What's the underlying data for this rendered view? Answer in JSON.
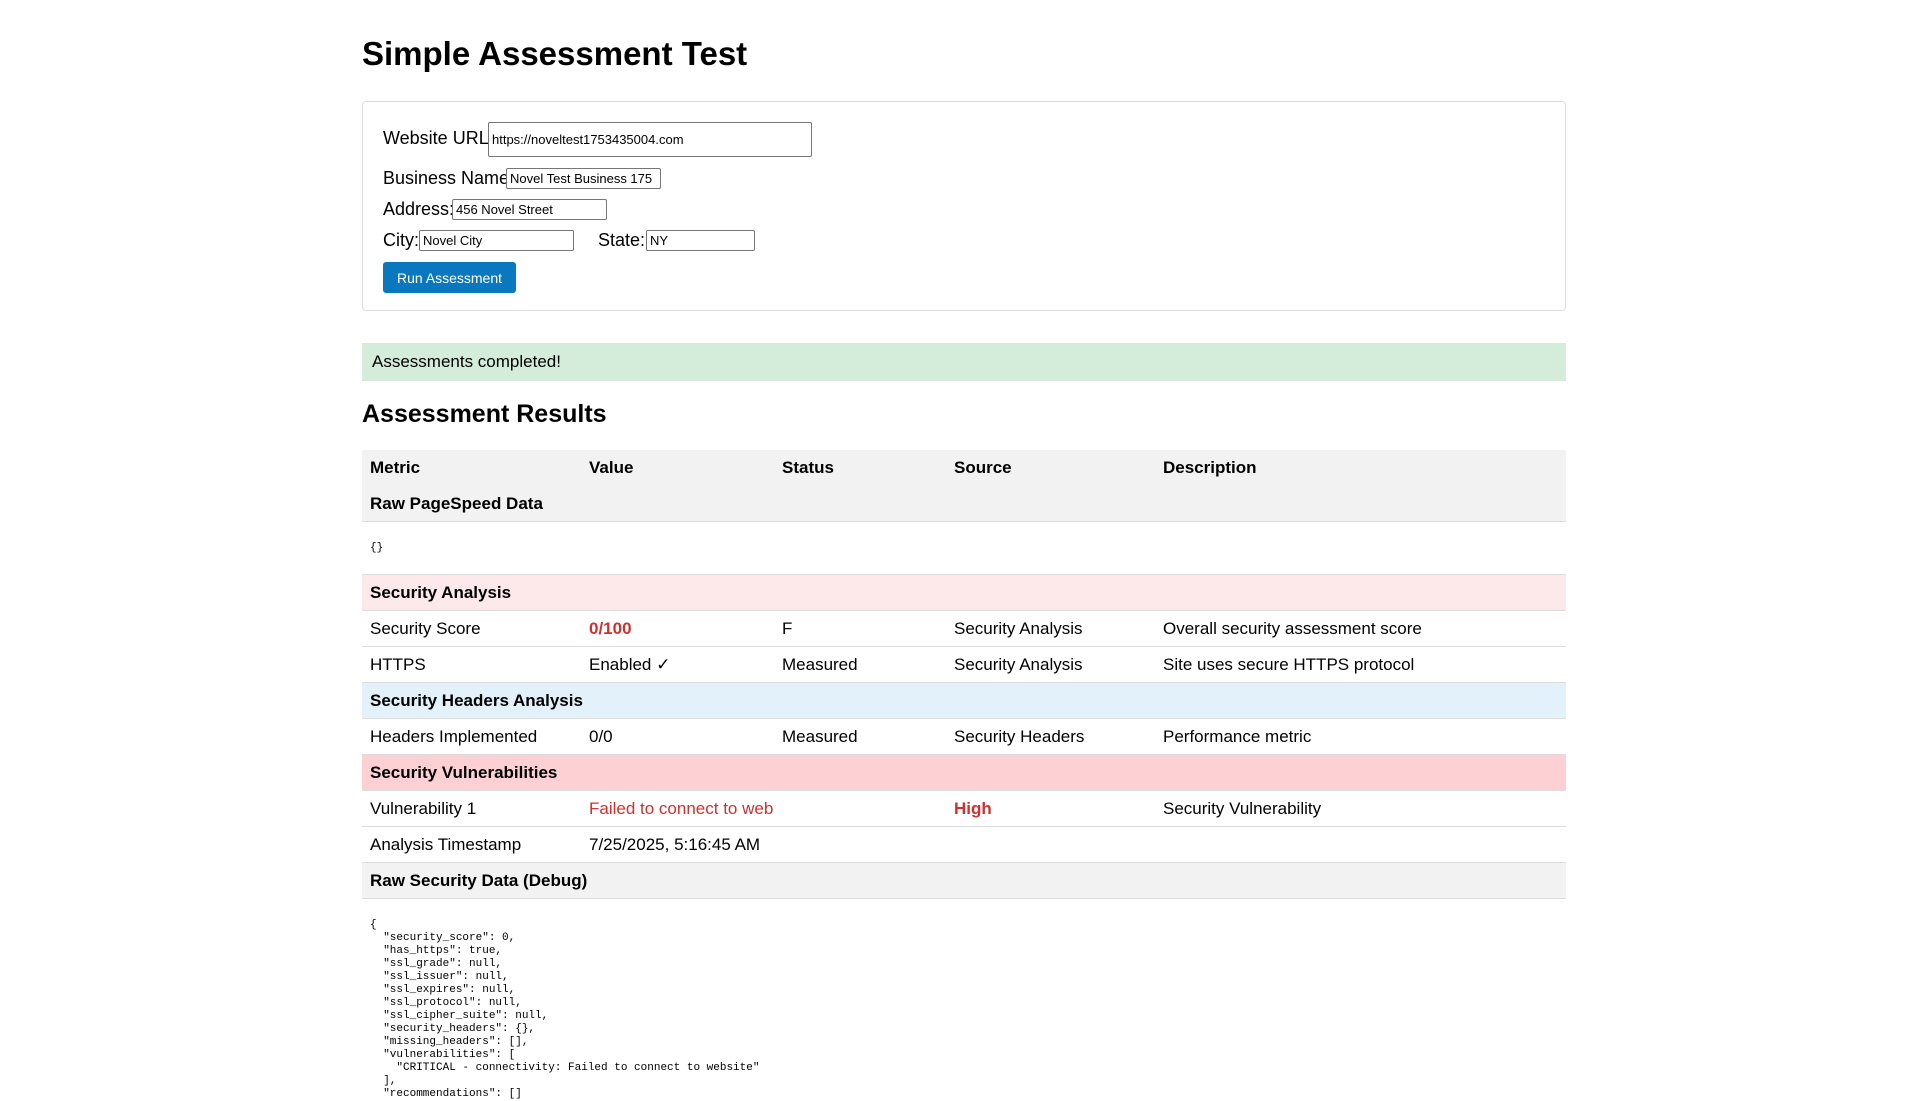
{
  "page": {
    "title": "Simple Assessment Test"
  },
  "form": {
    "website_url_label": "Website URL:",
    "website_url_value": "https://noveltest1753435004.com",
    "business_name_label": "Business Name:",
    "business_name_value": "Novel Test Business 175",
    "address_label": "Address:",
    "address_value": "456 Novel Street",
    "city_label": "City:",
    "city_value": "Novel City",
    "state_label": "State:",
    "state_value": "NY",
    "run_button_label": "Run Assessment"
  },
  "status": {
    "message": "Assessments completed!"
  },
  "results": {
    "heading": "Assessment Results",
    "columns": [
      "Metric",
      "Value",
      "Status",
      "Source",
      "Description"
    ],
    "raw_pagespeed": {
      "title": "Raw PageSpeed Data",
      "content": "{}"
    },
    "security_analysis": {
      "title": "Security Analysis",
      "rows": [
        {
          "metric": "Security Score",
          "value": "0/100",
          "status": "F",
          "source": "Security Analysis",
          "description": "Overall security assessment score"
        },
        {
          "metric": "HTTPS",
          "value": "Enabled ✓",
          "status": "Measured",
          "source": "Security Analysis",
          "description": "Site uses secure HTTPS protocol"
        }
      ]
    },
    "security_headers": {
      "title": "Security Headers Analysis",
      "rows": [
        {
          "metric": "Headers Implemented",
          "value": "0/0",
          "status": "Measured",
          "source": "Security Headers",
          "description": "Performance metric"
        }
      ]
    },
    "vulnerabilities": {
      "title": "Security Vulnerabilities",
      "rows": [
        {
          "metric": "Vulnerability 1",
          "value": "Failed to connect to website",
          "status": "",
          "source": "High",
          "description": "Security Vulnerability"
        }
      ]
    },
    "timestamp": {
      "metric": "Analysis Timestamp",
      "value": "7/25/2025, 5:16:45 AM"
    },
    "raw_security": {
      "title": "Raw Security Data (Debug)",
      "content": "{\n  \"security_score\": 0,\n  \"has_https\": true,\n  \"ssl_grade\": null,\n  \"ssl_issuer\": null,\n  \"ssl_expires\": null,\n  \"ssl_protocol\": null,\n  \"ssl_cipher_suite\": null,\n  \"security_headers\": {},\n  \"missing_headers\": [],\n  \"vulnerabilities\": [\n    \"CRITICAL - connectivity: Failed to connect to website\"\n  ],\n  \"recommendations\": []"
    }
  },
  "colors": {
    "button": "#0a78be",
    "success_bg": "#d4edda",
    "danger_text": "#d32f2f",
    "security_section_bg": "#fde9ea",
    "headers_section_bg": "#e3f1fb",
    "vulnerability_section_bg": "#fdd0d4"
  }
}
